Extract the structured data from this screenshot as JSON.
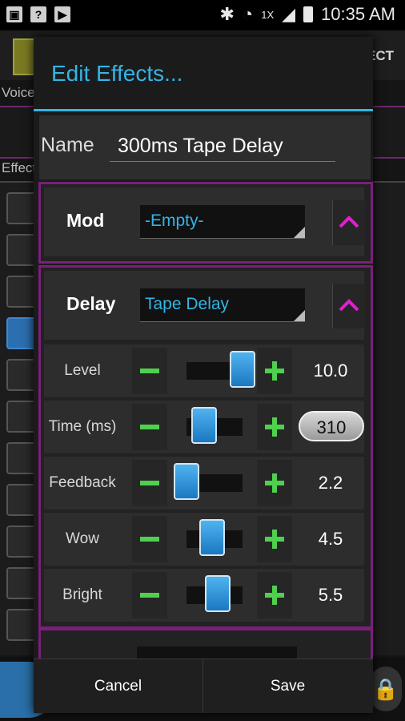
{
  "status_bar": {
    "time": "10:35 AM",
    "signal_label": "1X"
  },
  "background": {
    "voice_label": "Voice",
    "effect_label": "Effect",
    "header_button": "ECT"
  },
  "dialog": {
    "title": "Edit Effects...",
    "name_label": "Name",
    "name_value": "300ms Tape Delay",
    "sections": [
      {
        "label": "Mod",
        "selected": "-Empty-"
      },
      {
        "label": "Delay",
        "selected": "Tape Delay"
      }
    ],
    "params": [
      {
        "label": "Level",
        "value": "10.0",
        "slider_fraction": 1.0
      },
      {
        "label": "Time (ms)",
        "value": "310",
        "slider_fraction": 0.31
      },
      {
        "label": "Feedback",
        "value": "2.2",
        "slider_fraction": 0.0
      },
      {
        "label": "Wow",
        "value": "4.5",
        "slider_fraction": 0.45
      },
      {
        "label": "Bright",
        "value": "5.5",
        "slider_fraction": 0.55
      }
    ],
    "buttons": {
      "cancel": "Cancel",
      "save": "Save"
    }
  },
  "colors": {
    "accent": "#33b5e5",
    "section_border": "#7a1f7a",
    "plus_minus": "#4fd04f",
    "collapse": "#e020d0"
  }
}
